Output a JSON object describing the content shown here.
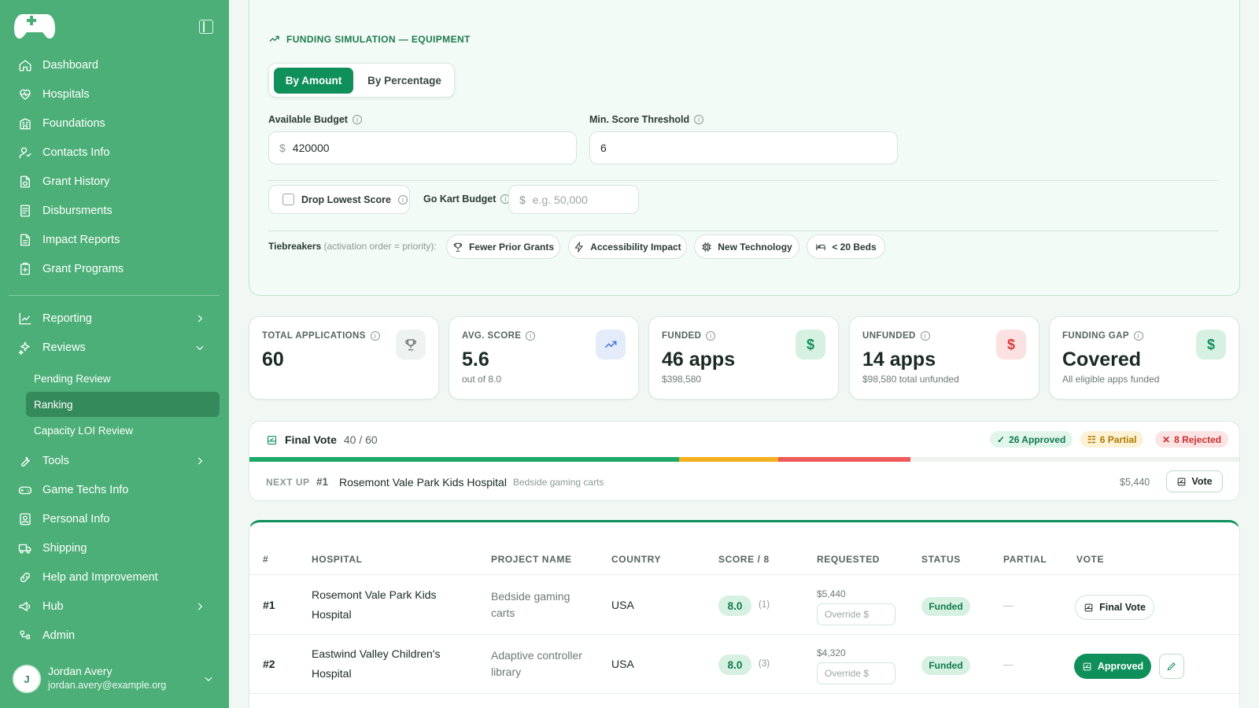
{
  "sidebar": {
    "logo_icon": "gamepad-icon",
    "nav": [
      {
        "label": "Dashboard",
        "icon": "home-icon"
      },
      {
        "label": "Hospitals",
        "icon": "heart-pulse-icon"
      },
      {
        "label": "Foundations",
        "icon": "building-icon"
      },
      {
        "label": "Contacts Info",
        "icon": "contacts-icon"
      },
      {
        "label": "Grant History",
        "icon": "document-history-icon"
      },
      {
        "label": "Disbursments",
        "icon": "document-list-icon"
      },
      {
        "label": "Impact Reports",
        "icon": "report-icon"
      },
      {
        "label": "Grant Programs",
        "icon": "clipboard-icon"
      },
      {
        "label": "Reporting",
        "icon": "chart-icon"
      },
      {
        "label": "Reviews",
        "icon": "sparkle-icon"
      },
      {
        "label": "Tools",
        "icon": "wrench-icon"
      },
      {
        "label": "Game Techs Info",
        "icon": "gamepad-small-icon"
      },
      {
        "label": "Personal Info",
        "icon": "id-card-icon"
      },
      {
        "label": "Shipping",
        "icon": "truck-icon"
      },
      {
        "label": "Help and Improvement",
        "icon": "link-icon"
      },
      {
        "label": "Hub",
        "icon": "megaphone-icon"
      },
      {
        "label": "Admin",
        "icon": "admin-icon"
      }
    ],
    "reviews_sub": [
      "Pending Review",
      "Ranking",
      "Capacity LOI Review"
    ],
    "active_sub": "Ranking",
    "user": {
      "initial": "J",
      "name": "Jordan Avery",
      "email": "jordan.avery@example.org"
    }
  },
  "simulation": {
    "title": "FUNDING SIMULATION — EQUIPMENT",
    "mode_amount": "By Amount",
    "mode_percentage": "By Percentage",
    "available_budget_label": "Available Budget",
    "currency_symbol": "$",
    "available_budget_value": "420000",
    "min_score_label": "Min. Score Threshold",
    "min_score_value": "6",
    "drop_lowest_label": "Drop Lowest Score",
    "go_kart_label": "Go Kart Budget",
    "go_kart_placeholder": "e.g. 50,000",
    "tiebreakers_label": "Tiebreakers",
    "tiebreakers_hint": "(activation order = priority):",
    "tiebreakers": [
      {
        "label": "Fewer Prior Grants",
        "icon": "trophy-icon"
      },
      {
        "label": "Accessibility Impact",
        "icon": "bolt-icon"
      },
      {
        "label": "New Technology",
        "icon": "chip-icon"
      },
      {
        "label": "< 20 Beds",
        "icon": "bed-icon"
      }
    ]
  },
  "stats": [
    {
      "label": "TOTAL APPLICATIONS",
      "value": "60",
      "sub": "",
      "icon": "trophy-icon",
      "color": "#5b6b64",
      "bg": "#eef2f0"
    },
    {
      "label": "AVG. SCORE",
      "value": "5.6",
      "sub": "out of 8.0",
      "icon": "trend-up-icon",
      "color": "#3b6fd8",
      "bg": "#e4ecfb"
    },
    {
      "label": "FUNDED",
      "value": "46 apps",
      "sub": "$398,580",
      "icon": "dollar-icon",
      "color": "#0f8f5a",
      "bg": "#d6f1e1"
    },
    {
      "label": "UNFUNDED",
      "value": "14 apps",
      "sub": "$98,580 total unfunded",
      "icon": "dollar-icon",
      "color": "#d63b3b",
      "bg": "#fbe1e1"
    },
    {
      "label": "FUNDING GAP",
      "value": "Covered",
      "sub": "All eligible apps funded",
      "icon": "dollar-icon",
      "color": "#0f8f5a",
      "bg": "#d6f1e1"
    }
  ],
  "final_vote": {
    "title": "Final Vote",
    "count": "40 / 60",
    "approved_badge": "26 Approved",
    "partial_badge": "6 Partial",
    "rejected_badge": "8 Rejected",
    "approved": 26,
    "partial": 6,
    "rejected": 8,
    "total": 60,
    "next_label": "NEXT UP",
    "next_rank": "#1",
    "next_hospital": "Rosemont Vale Park Kids Hospital",
    "next_project": "Bedside gaming carts",
    "next_amount": "$5,440",
    "vote_label": "Vote",
    "colors": {
      "approved": "#1ea86a",
      "partial": "#f2b01e",
      "rejected": "#ef5a5a"
    }
  },
  "table": {
    "headers": [
      "#",
      "HOSPITAL",
      "PROJECT NAME",
      "COUNTRY",
      "SCORE / 8",
      "REQUESTED",
      "STATUS",
      "PARTIAL",
      "VOTE"
    ],
    "override_placeholder": "Override $",
    "rows": [
      {
        "rank": "#1",
        "hospital_1": "Rosemont Vale Park Kids",
        "hospital_2": "Hospital",
        "project_1": "Bedside gaming",
        "project_2": "carts",
        "country": "USA",
        "score": "8.0",
        "score_n": "(1)",
        "requested": "$5,440",
        "status": "Funded",
        "partial": "—",
        "vote": "Final Vote"
      },
      {
        "rank": "#2",
        "hospital_1": "Eastwind Valley Children's",
        "hospital_2": "Hospital",
        "project_1": "Adaptive controller",
        "project_2": "library",
        "country": "USA",
        "score": "8.0",
        "score_n": "(3)",
        "requested": "$4,320",
        "status": "Funded",
        "partial": "—",
        "vote": "Approved"
      }
    ]
  }
}
